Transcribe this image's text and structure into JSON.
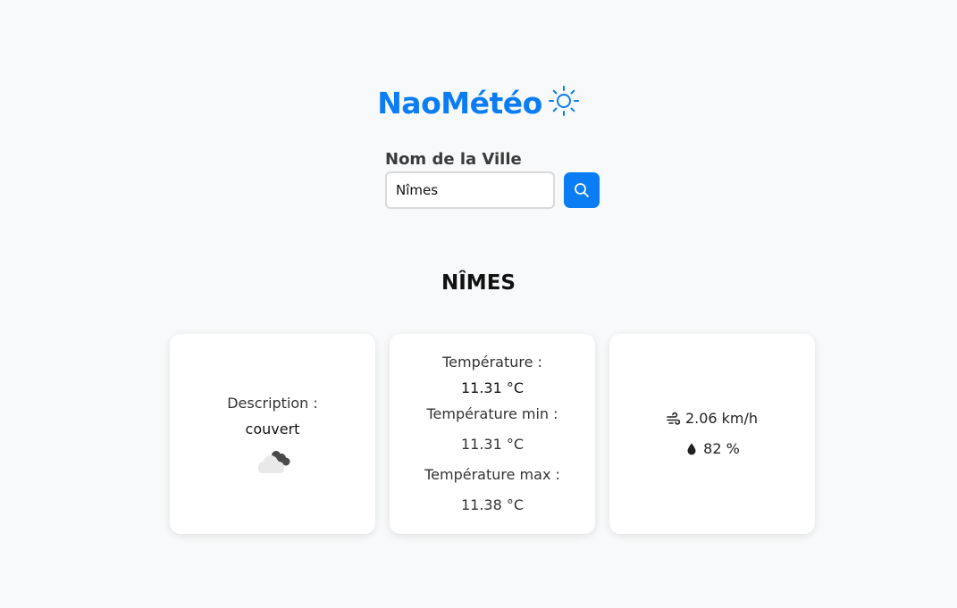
{
  "header": {
    "title": "NaoMétéo",
    "icon": "sun-icon",
    "accent_color": "#0a7df5"
  },
  "search": {
    "label": "Nom de la Ville",
    "value": "Nîmes",
    "button_icon": "search-icon"
  },
  "city": {
    "name": "NÎMES"
  },
  "cards": {
    "description": {
      "label": "Description :",
      "value": "couvert",
      "icon": "cloud-icon"
    },
    "temperature": {
      "label": "Température :",
      "value": "11.31 °C",
      "min_label": "Température min :",
      "min_value": "11.31 °C",
      "max_label": "Température max :",
      "max_value": "11.38 °C"
    },
    "conditions": {
      "wind": "2.06 km/h",
      "wind_icon": "wind-icon",
      "humidity": "82 %",
      "humidity_icon": "droplet-icon"
    }
  }
}
